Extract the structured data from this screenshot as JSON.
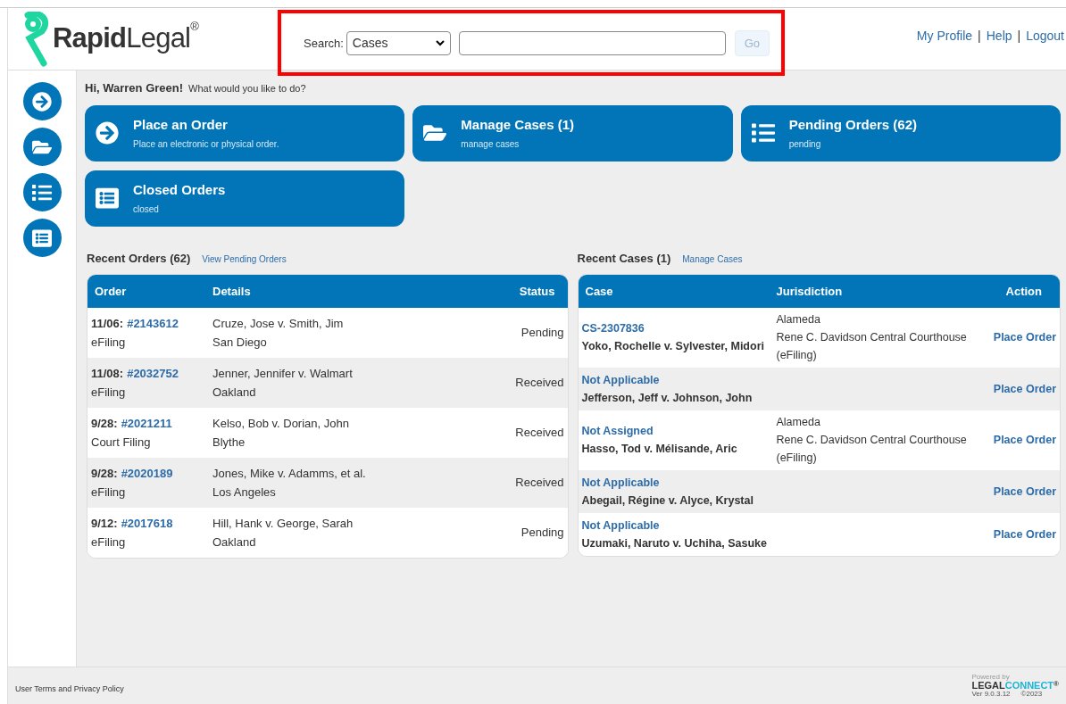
{
  "header": {
    "logo": {
      "bold": "Rapid",
      "light": "Legal",
      "mark": "®"
    },
    "search": {
      "label": "Search:",
      "scope": "Cases",
      "button": "Go",
      "button_disabled": true
    },
    "links": [
      "My Profile",
      "Help",
      "Logout"
    ],
    "link_separator": "|"
  },
  "highlight_box": true,
  "sidebar": {
    "items": [
      {
        "kind": "arrow"
      },
      {
        "kind": "folder"
      },
      {
        "kind": "list"
      },
      {
        "kind": "card"
      }
    ]
  },
  "greeting": {
    "name": "Hi, Warren Green!",
    "prompt": "What would you like to do?"
  },
  "tiles": [
    {
      "kind": "arrow",
      "title": "Place an Order",
      "subtitle": "Place an electronic or physical order."
    },
    {
      "kind": "folder",
      "title": "Manage Cases (1)",
      "subtitle": "manage cases"
    },
    {
      "kind": "list",
      "title": "Pending Orders (62)",
      "subtitle": "pending"
    },
    {
      "kind": "card",
      "title": "Closed Orders",
      "subtitle": "closed"
    }
  ],
  "recent_orders": {
    "title": "Recent Orders (62)",
    "link": "View Pending Orders",
    "columns": [
      "Order",
      "Details",
      "Status"
    ],
    "rows": [
      {
        "date": "11/06:",
        "order": "#2143612",
        "type": "eFiling",
        "details": "Cruze, Jose v. Smith, Jim",
        "location": "San Diego",
        "status": "Pending"
      },
      {
        "date": "11/08:",
        "order": "#2032752",
        "type": "eFiling",
        "details": "Jenner, Jennifer v. Walmart",
        "location": "Oakland",
        "status": "Received"
      },
      {
        "date": "9/28:",
        "order": "#2021211",
        "type": "Court Filing",
        "details": "Kelso, Bob v. Dorian, John",
        "location": "Blythe",
        "status": "Received"
      },
      {
        "date": "9/28:",
        "order": "#2020189",
        "type": "eFiling",
        "details": "Jones, Mike v. Adamms, et al.",
        "location": "Los Angeles",
        "status": "Received"
      },
      {
        "date": "9/12:",
        "order": "#2017618",
        "type": "eFiling",
        "details": "Hill, Hank v. George, Sarah",
        "location": "Oakland",
        "status": "Pending"
      }
    ]
  },
  "recent_cases": {
    "title": "Recent Cases (1)",
    "link": "Manage Cases",
    "columns": [
      "Case",
      "Jurisdiction",
      "Action"
    ],
    "rows": [
      {
        "case": "CS-2307836",
        "parties": "Yoko, Rochelle v. Sylvester, Midori",
        "jurisdiction": [
          "Alameda",
          "Rene C. Davidson Central Courthouse",
          "(eFiling)"
        ],
        "action": "Place Order"
      },
      {
        "case": "Not Applicable",
        "parties": "Jefferson, Jeff v. Johnson, John",
        "action": "Place Order"
      },
      {
        "case": "Not Assigned",
        "parties": "Hasso, Tod v. Mélisande, Aric",
        "jurisdiction": [
          "Alameda",
          "Rene C. Davidson Central Courthouse",
          "(eFiling)"
        ],
        "action": "Place Order"
      },
      {
        "case": "Not Applicable",
        "parties": "Abegail, Régine v. Alyce, Krystal",
        "action": "Place Order"
      },
      {
        "case": "Not Applicable",
        "parties": "Uzumaki, Naruto v. Uchiha, Sasuke",
        "action": "Place Order"
      }
    ]
  },
  "footer": {
    "terms": "User Terms and Privacy Policy",
    "powered": "Powered by",
    "brand_a": "LEGAL",
    "brand_b": "CONNECT",
    "brand_mark": "®",
    "version": "Ver 9.0.3.12",
    "copyright": "©2023"
  }
}
